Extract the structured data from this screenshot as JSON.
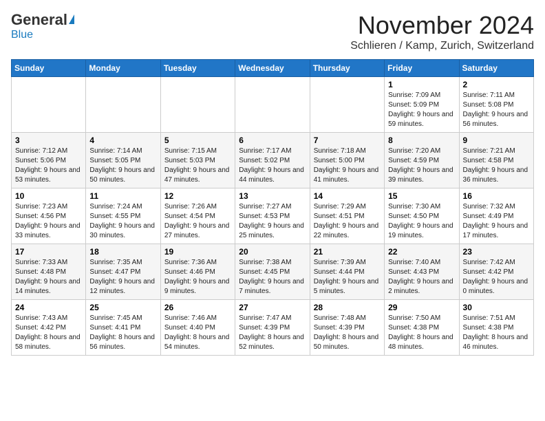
{
  "header": {
    "logo_general": "General",
    "logo_blue": "Blue",
    "month_title": "November 2024",
    "location": "Schlieren / Kamp, Zurich, Switzerland"
  },
  "calendar": {
    "days_of_week": [
      "Sunday",
      "Monday",
      "Tuesday",
      "Wednesday",
      "Thursday",
      "Friday",
      "Saturday"
    ],
    "weeks": [
      [
        {
          "day": "",
          "info": ""
        },
        {
          "day": "",
          "info": ""
        },
        {
          "day": "",
          "info": ""
        },
        {
          "day": "",
          "info": ""
        },
        {
          "day": "",
          "info": ""
        },
        {
          "day": "1",
          "info": "Sunrise: 7:09 AM\nSunset: 5:09 PM\nDaylight: 9 hours and 59 minutes."
        },
        {
          "day": "2",
          "info": "Sunrise: 7:11 AM\nSunset: 5:08 PM\nDaylight: 9 hours and 56 minutes."
        }
      ],
      [
        {
          "day": "3",
          "info": "Sunrise: 7:12 AM\nSunset: 5:06 PM\nDaylight: 9 hours and 53 minutes."
        },
        {
          "day": "4",
          "info": "Sunrise: 7:14 AM\nSunset: 5:05 PM\nDaylight: 9 hours and 50 minutes."
        },
        {
          "day": "5",
          "info": "Sunrise: 7:15 AM\nSunset: 5:03 PM\nDaylight: 9 hours and 47 minutes."
        },
        {
          "day": "6",
          "info": "Sunrise: 7:17 AM\nSunset: 5:02 PM\nDaylight: 9 hours and 44 minutes."
        },
        {
          "day": "7",
          "info": "Sunrise: 7:18 AM\nSunset: 5:00 PM\nDaylight: 9 hours and 41 minutes."
        },
        {
          "day": "8",
          "info": "Sunrise: 7:20 AM\nSunset: 4:59 PM\nDaylight: 9 hours and 39 minutes."
        },
        {
          "day": "9",
          "info": "Sunrise: 7:21 AM\nSunset: 4:58 PM\nDaylight: 9 hours and 36 minutes."
        }
      ],
      [
        {
          "day": "10",
          "info": "Sunrise: 7:23 AM\nSunset: 4:56 PM\nDaylight: 9 hours and 33 minutes."
        },
        {
          "day": "11",
          "info": "Sunrise: 7:24 AM\nSunset: 4:55 PM\nDaylight: 9 hours and 30 minutes."
        },
        {
          "day": "12",
          "info": "Sunrise: 7:26 AM\nSunset: 4:54 PM\nDaylight: 9 hours and 27 minutes."
        },
        {
          "day": "13",
          "info": "Sunrise: 7:27 AM\nSunset: 4:53 PM\nDaylight: 9 hours and 25 minutes."
        },
        {
          "day": "14",
          "info": "Sunrise: 7:29 AM\nSunset: 4:51 PM\nDaylight: 9 hours and 22 minutes."
        },
        {
          "day": "15",
          "info": "Sunrise: 7:30 AM\nSunset: 4:50 PM\nDaylight: 9 hours and 19 minutes."
        },
        {
          "day": "16",
          "info": "Sunrise: 7:32 AM\nSunset: 4:49 PM\nDaylight: 9 hours and 17 minutes."
        }
      ],
      [
        {
          "day": "17",
          "info": "Sunrise: 7:33 AM\nSunset: 4:48 PM\nDaylight: 9 hours and 14 minutes."
        },
        {
          "day": "18",
          "info": "Sunrise: 7:35 AM\nSunset: 4:47 PM\nDaylight: 9 hours and 12 minutes."
        },
        {
          "day": "19",
          "info": "Sunrise: 7:36 AM\nSunset: 4:46 PM\nDaylight: 9 hours and 9 minutes."
        },
        {
          "day": "20",
          "info": "Sunrise: 7:38 AM\nSunset: 4:45 PM\nDaylight: 9 hours and 7 minutes."
        },
        {
          "day": "21",
          "info": "Sunrise: 7:39 AM\nSunset: 4:44 PM\nDaylight: 9 hours and 5 minutes."
        },
        {
          "day": "22",
          "info": "Sunrise: 7:40 AM\nSunset: 4:43 PM\nDaylight: 9 hours and 2 minutes."
        },
        {
          "day": "23",
          "info": "Sunrise: 7:42 AM\nSunset: 4:42 PM\nDaylight: 9 hours and 0 minutes."
        }
      ],
      [
        {
          "day": "24",
          "info": "Sunrise: 7:43 AM\nSunset: 4:42 PM\nDaylight: 8 hours and 58 minutes."
        },
        {
          "day": "25",
          "info": "Sunrise: 7:45 AM\nSunset: 4:41 PM\nDaylight: 8 hours and 56 minutes."
        },
        {
          "day": "26",
          "info": "Sunrise: 7:46 AM\nSunset: 4:40 PM\nDaylight: 8 hours and 54 minutes."
        },
        {
          "day": "27",
          "info": "Sunrise: 7:47 AM\nSunset: 4:39 PM\nDaylight: 8 hours and 52 minutes."
        },
        {
          "day": "28",
          "info": "Sunrise: 7:48 AM\nSunset: 4:39 PM\nDaylight: 8 hours and 50 minutes."
        },
        {
          "day": "29",
          "info": "Sunrise: 7:50 AM\nSunset: 4:38 PM\nDaylight: 8 hours and 48 minutes."
        },
        {
          "day": "30",
          "info": "Sunrise: 7:51 AM\nSunset: 4:38 PM\nDaylight: 8 hours and 46 minutes."
        }
      ]
    ]
  }
}
